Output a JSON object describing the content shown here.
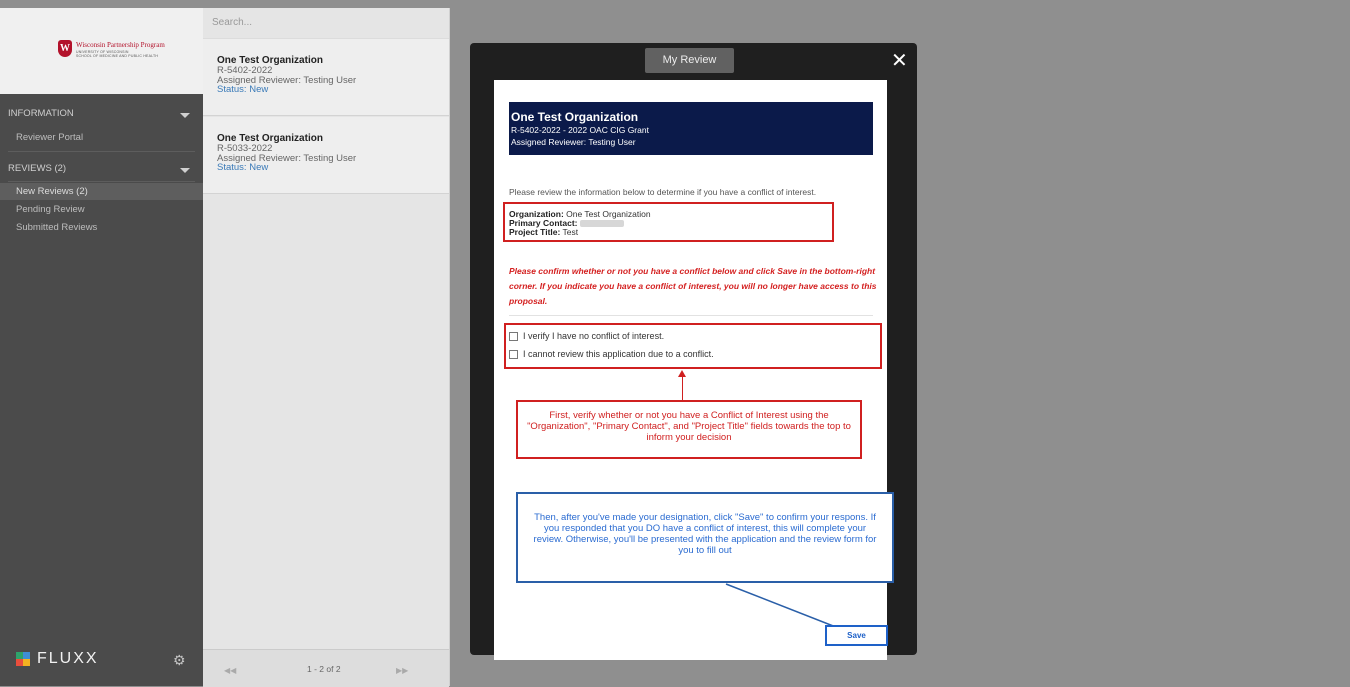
{
  "sidebar": {
    "logo": {
      "title": "Wisconsin Partnership Program",
      "sub1": "UNIVERSITY OF WISCONSIN",
      "sub2": "SCHOOL OF MEDICINE AND PUBLIC HEALTH",
      "crest": "W"
    },
    "sections": [
      {
        "label": "INFORMATION",
        "items": [
          {
            "label": "Reviewer Portal",
            "active": false
          }
        ]
      },
      {
        "label": "REVIEWS (2)",
        "items": [
          {
            "label": "New Reviews  (2)",
            "active": true
          },
          {
            "label": "Pending Review",
            "active": false
          },
          {
            "label": "Submitted Reviews",
            "active": false
          }
        ]
      }
    ],
    "brand": "FLUXX",
    "brand_colors": [
      "#e94e3c",
      "#f4b221",
      "#2ea36b",
      "#3f8ed6"
    ]
  },
  "list": {
    "search_placeholder": "Search...",
    "items": [
      {
        "org": "One Test Organization",
        "id": "R-5402-2022",
        "reviewer": "Assigned Reviewer: Testing User",
        "status": "Status: New"
      },
      {
        "org": "One Test Organization",
        "id": "R-5033-2022",
        "reviewer": "Assigned Reviewer: Testing User",
        "status": "Status: New"
      }
    ],
    "pager": {
      "prev": "◀◀",
      "info": "1 - 2 of 2",
      "next": "▶▶"
    }
  },
  "modal": {
    "title": "My Review",
    "close": "✕",
    "header": {
      "title": "One Test Organization",
      "subtitle": "R-5402-2022 - 2022 OAC CIG Grant",
      "reviewer": "Assigned Reviewer: Testing User"
    },
    "instruction": "Please review the information below to determine if you have a conflict of interest.",
    "info": {
      "org_label": "Organization:",
      "org_value": "One Test Organization",
      "contact_label": "Primary Contact:",
      "title_label": "Project Title:",
      "title_value": "Test"
    },
    "warning": "Please confirm whether or not you have a conflict below and click Save in the bottom-right corner. If you indicate you have a conflict of interest, you will no longer have access to this proposal.",
    "options": [
      "I verify I have no conflict of interest.",
      "I cannot review this application due to a conflict."
    ],
    "callout1": "First, verify whether or not you have a Conflict of Interest using the \"Organization\", \"Primary Contact\", and \"Project Title\" fields towards the top to inform your decision",
    "callout2": "Then, after you've made your designation, click \"Save\" to confirm your respons. If you responded that you DO have a conflict of interest, this will complete your review. Otherwise, you'll be presented with the application and the review form for you to fill out",
    "save": "Save"
  },
  "colors": {
    "header_bg": "#0b1a4a",
    "annotation_red": "#d02020",
    "annotation_blue": "#2a5fa8",
    "status_blue": "#3a7ab8"
  }
}
